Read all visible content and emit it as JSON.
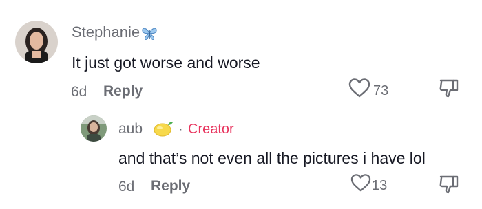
{
  "comment": {
    "username": "Stephanie",
    "username_emoji": "butterfly-emoji",
    "text": "It just got worse and worse",
    "time": "6d",
    "reply_label": "Reply",
    "likes": "73"
  },
  "reply": {
    "username": "aub",
    "username_emoji": "lemon-emoji",
    "separator": "·",
    "badge": "Creator",
    "text": "and that’s not even all the pictures i have lol",
    "time": "6d",
    "reply_label": "Reply",
    "likes": "13"
  },
  "colors": {
    "text": "#161823",
    "muted": "#6b6d74",
    "creator_badge": "#e8335d",
    "butterfly": "#6fa8dc",
    "lemon": "#f7d94c"
  },
  "icons": {
    "like": "heart-outline-icon",
    "dislike": "thumbs-down-outline-icon"
  }
}
